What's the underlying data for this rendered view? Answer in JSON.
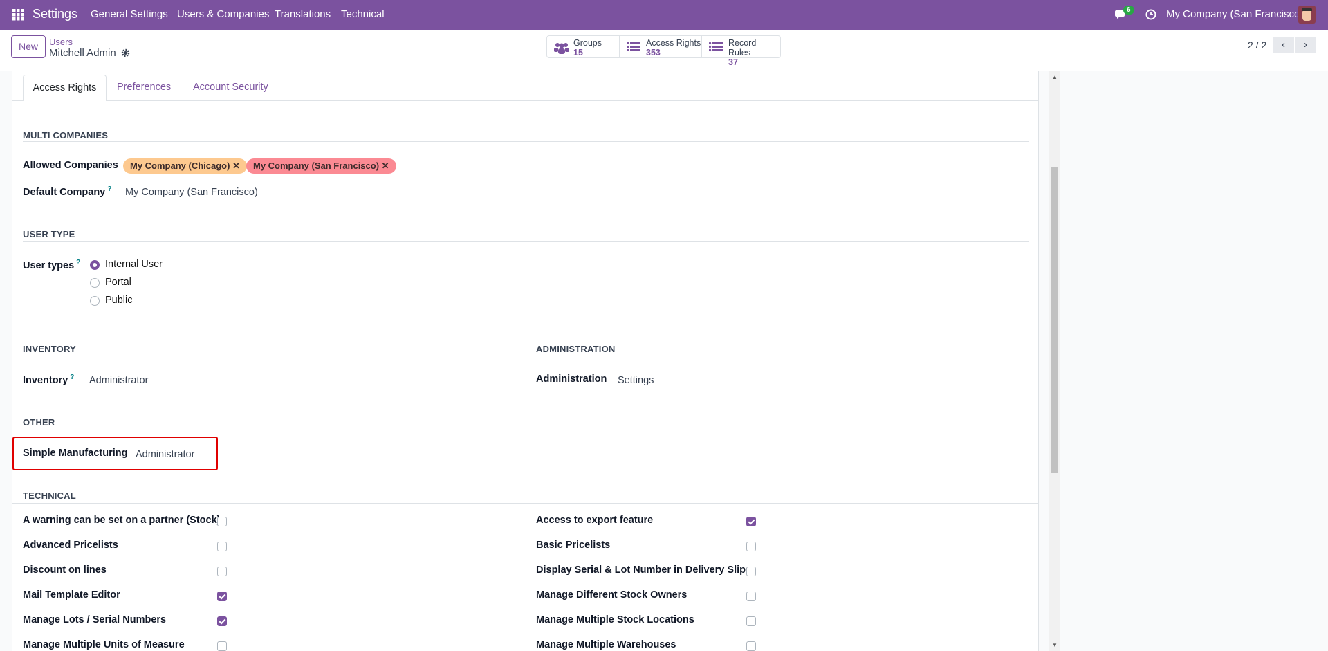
{
  "navbar": {
    "app_name": "Settings",
    "menus": [
      "General Settings",
      "Users & Companies",
      "Translations",
      "Technical"
    ],
    "chat_count": "6",
    "company": "My Company (San Francisco)"
  },
  "control_panel": {
    "new_label": "New",
    "breadcrumb_parent": "Users",
    "record_name": "Mitchell Admin",
    "stats": [
      {
        "label": "Groups",
        "value": "15"
      },
      {
        "label": "Access Rights",
        "value": "353"
      },
      {
        "label": "Record Rules",
        "value": "37"
      }
    ],
    "pager": "2 / 2"
  },
  "tabs": [
    "Access Rights",
    "Preferences",
    "Account Security"
  ],
  "multi_companies": {
    "title": "MULTI COMPANIES",
    "allowed_label": "Allowed Companies",
    "allowed": [
      "My Company (Chicago)",
      "My Company (San Francisco)"
    ],
    "default_label": "Default Company",
    "default_value": "My Company (San Francisco)",
    "help": "?"
  },
  "user_type": {
    "title": "USER TYPE",
    "label": "User types",
    "options": [
      "Internal User",
      "Portal",
      "Public"
    ],
    "selected": "Internal User"
  },
  "inventory": {
    "title": "INVENTORY",
    "label": "Inventory",
    "value": "Administrator"
  },
  "administration": {
    "title": "ADMINISTRATION",
    "label": "Administration",
    "value": "Settings"
  },
  "other": {
    "title": "OTHER",
    "label": "Simple Manufacturing",
    "value": "Administrator"
  },
  "technical": {
    "title": "TECHNICAL",
    "left": [
      {
        "label": "A warning can be set on a partner (Stock)",
        "checked": false
      },
      {
        "label": "Advanced Pricelists",
        "checked": false
      },
      {
        "label": "Discount on lines",
        "checked": false
      },
      {
        "label": "Mail Template Editor",
        "checked": true
      },
      {
        "label": "Manage Lots / Serial Numbers",
        "checked": true
      },
      {
        "label": "Manage Multiple Units of Measure",
        "checked": false
      }
    ],
    "right": [
      {
        "label": "Access to export feature",
        "checked": true
      },
      {
        "label": "Basic Pricelists",
        "checked": false
      },
      {
        "label": "Display Serial & Lot Number in Delivery Slips",
        "checked": false
      },
      {
        "label": "Manage Different Stock Owners",
        "checked": false
      },
      {
        "label": "Manage Multiple Stock Locations",
        "checked": false
      },
      {
        "label": "Manage Multiple Warehouses",
        "checked": false
      }
    ]
  },
  "colors": {
    "brand": "#7b529f",
    "tag_chicago": "#fdc98f",
    "tag_sf": "#fb8a93",
    "highlight": "#e00000"
  }
}
